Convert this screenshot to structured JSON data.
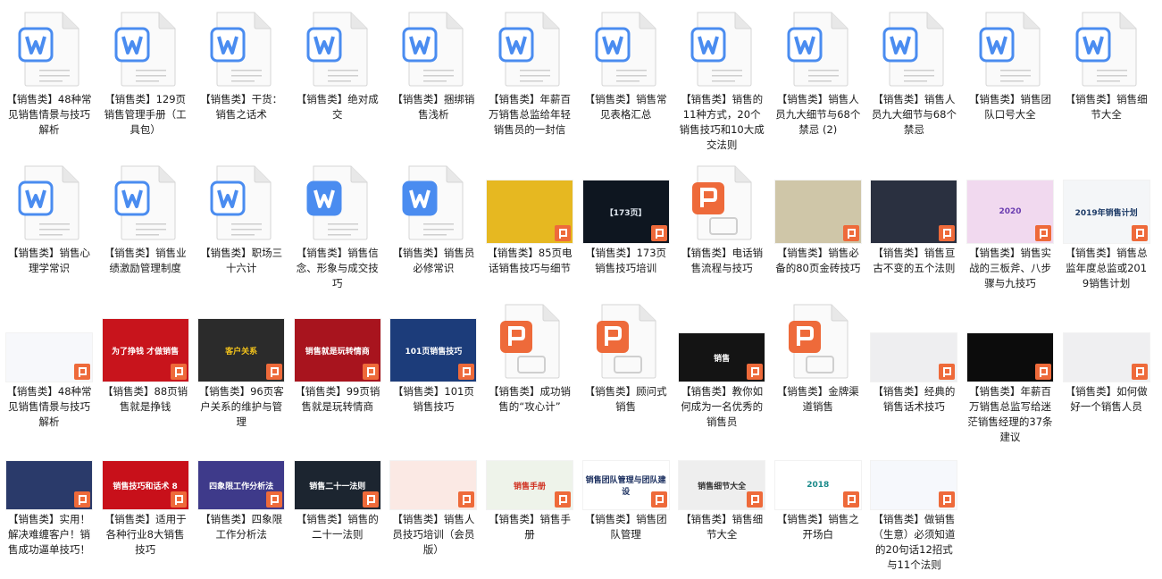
{
  "colors": {
    "word": "#4a8cf0",
    "ppt": "#ee6a3a",
    "label": "#1a1a1a"
  },
  "items": [
    {
      "label": "【销售类】48种常见销售情景与技巧解析",
      "icon": "word"
    },
    {
      "label": "【销售类】129页销售管理手册（工具包）",
      "icon": "word"
    },
    {
      "label": "【销售类】干货：销售之话术",
      "icon": "word"
    },
    {
      "label": "【销售类】绝对成交",
      "icon": "word"
    },
    {
      "label": "【销售类】捆绑销售浅析",
      "icon": "word"
    },
    {
      "label": "【销售类】年薪百万销售总监给年轻销售员的一封信",
      "icon": "word"
    },
    {
      "label": "【销售类】销售常见表格汇总",
      "icon": "word"
    },
    {
      "label": "【销售类】销售的11种方式，20个销售技巧和10大成交法则",
      "icon": "word"
    },
    {
      "label": "【销售类】销售人员九大细节与68个禁忌 (2)",
      "icon": "word"
    },
    {
      "label": "【销售类】销售人员九大细节与68个禁忌",
      "icon": "word"
    },
    {
      "label": "【销售类】销售团队口号大全",
      "icon": "word"
    },
    {
      "label": "【销售类】销售细节大全",
      "icon": "word"
    },
    {
      "label": "【销售类】销售心理学常识",
      "icon": "word"
    },
    {
      "label": "【销售类】销售业绩激励管理制度",
      "icon": "word"
    },
    {
      "label": "【销售类】职场三十六计",
      "icon": "word"
    },
    {
      "label": "【销售类】销售信念、形象与成交技巧",
      "icon": "word-solid"
    },
    {
      "label": "【销售类】销售员必修常识",
      "icon": "word-solid"
    },
    {
      "label": "【销售类】85页电话销售技巧与细节",
      "icon": "thumb",
      "bg": "#e6b821",
      "fg": "#3a2a6a",
      "ratio": "4:3",
      "text": ""
    },
    {
      "label": "【销售类】173页销售技巧培训",
      "icon": "thumb",
      "bg": "#0e1620",
      "fg": "#dfe6ee",
      "ratio": "4:3",
      "text": "【173页】"
    },
    {
      "label": "【销售类】电话销售流程与技巧",
      "icon": "ppt"
    },
    {
      "label": "【销售类】销售必备的80页金砖技巧",
      "icon": "thumb",
      "bg": "#cfc6a8",
      "fg": "#3a3a20",
      "ratio": "4:3",
      "text": ""
    },
    {
      "label": "【销售类】销售亘古不变的五个法则",
      "icon": "thumb",
      "bg": "#2a3040",
      "fg": "#c9e04a",
      "ratio": "4:3",
      "text": ""
    },
    {
      "label": "【销售类】销售实战的三板斧、八步骤与九技巧",
      "icon": "thumb",
      "bg": "#f1d9ef",
      "fg": "#6a3cb0",
      "ratio": "4:3",
      "text": "2020"
    },
    {
      "label": "【销售类】销售总监年度总监或2019销售计划",
      "icon": "thumb",
      "bg": "#f4f6f8",
      "fg": "#1c3a66",
      "ratio": "4:3",
      "text": "2019年销售计划"
    },
    {
      "label": "【销售类】48种常见销售情景与技巧解析",
      "icon": "thumb",
      "bg": "#f7f8fb",
      "fg": "#2a3a70",
      "ratio": "16:9",
      "text": ""
    },
    {
      "label": "【销售类】88页销售就是挣钱",
      "icon": "thumb",
      "bg": "#c8141c",
      "fg": "#ffffff",
      "ratio": "4:3",
      "text": "为了挣钱 才做销售"
    },
    {
      "label": "【销售类】96页客户关系的维护与管理",
      "icon": "thumb",
      "bg": "#2b2b2b",
      "fg": "#f2c21b",
      "ratio": "4:3",
      "text": "客户关系"
    },
    {
      "label": "【销售类】99页销售就是玩转情商",
      "icon": "thumb",
      "bg": "#a8141e",
      "fg": "#ffffff",
      "ratio": "4:3",
      "text": "销售就是玩转情商"
    },
    {
      "label": "【销售类】101页销售技巧",
      "icon": "thumb",
      "bg": "#1c3c7a",
      "fg": "#ffffff",
      "ratio": "4:3",
      "text": "101页销售技巧"
    },
    {
      "label": "【销售类】成功销售的“攻心计”",
      "icon": "ppt"
    },
    {
      "label": "【销售类】顾问式销售",
      "icon": "ppt"
    },
    {
      "label": "【销售类】教你如何成为一名优秀的销售员",
      "icon": "thumb",
      "bg": "#141414",
      "fg": "#ffffff",
      "ratio": "16:9",
      "text": "销售"
    },
    {
      "label": "【销售类】金牌渠道销售",
      "icon": "ppt"
    },
    {
      "label": "【销售类】经典的销售话术技巧",
      "icon": "thumb",
      "bg": "#eeeef0",
      "fg": "#333333",
      "ratio": "16:9",
      "text": ""
    },
    {
      "label": "【销售类】年薪百万销售总监写给迷茫销售经理的37条建议",
      "icon": "thumb",
      "bg": "#0c0c0c",
      "fg": "#e0e0e0",
      "ratio": "16:9",
      "text": ""
    },
    {
      "label": "【销售类】如何做好一个销售人员",
      "icon": "thumb",
      "bg": "#efeff1",
      "fg": "#333333",
      "ratio": "16:9",
      "text": ""
    },
    {
      "label": "【销售类】实用！解决难缠客户！销售成功逼单技巧！",
      "icon": "thumb",
      "bg": "#2a3a6a",
      "fg": "#ffffff",
      "ratio": "16:9",
      "text": ""
    },
    {
      "label": "【销售类】适用于各种行业8大销售技巧",
      "icon": "thumb",
      "bg": "#c8101a",
      "fg": "#ffffff",
      "ratio": "16:9",
      "text": "销售技巧和话术 8"
    },
    {
      "label": "【销售类】四象限工作分析法",
      "icon": "thumb",
      "bg": "#3e3a8a",
      "fg": "#ffffff",
      "ratio": "16:9",
      "text": "四象限工作分析法"
    },
    {
      "label": "【销售类】销售的二十一法则",
      "icon": "thumb",
      "bg": "#1c2530",
      "fg": "#ffffff",
      "ratio": "16:9",
      "text": "销售二十一法则"
    },
    {
      "label": "【销售类】销售人员技巧培训（会员版）",
      "icon": "thumb",
      "bg": "#fbe9e4",
      "fg": "#c04040",
      "ratio": "16:9",
      "text": ""
    },
    {
      "label": "【销售类】销售手册",
      "icon": "thumb",
      "bg": "#eef3ea",
      "fg": "#d03020",
      "ratio": "16:9",
      "text": "销售手册"
    },
    {
      "label": "【销售类】销售团队管理",
      "icon": "thumb",
      "bg": "#ffffff",
      "fg": "#1c3060",
      "ratio": "16:9",
      "text": "销售团队管理与团队建设"
    },
    {
      "label": "【销售类】销售细节大全",
      "icon": "thumb",
      "bg": "#eeeeee",
      "fg": "#333333",
      "ratio": "16:9",
      "text": "销售细节大全"
    },
    {
      "label": "【销售类】销售之开场白",
      "icon": "thumb",
      "bg": "#ffffff",
      "fg": "#1a8a8a",
      "ratio": "16:9",
      "text": "2018"
    },
    {
      "label": "【销售类】做销售（生意）必须知道的20句话12招式与11个法则",
      "icon": "thumb",
      "bg": "#f6f8fc",
      "fg": "#2a5aa0",
      "ratio": "16:9",
      "text": ""
    }
  ]
}
